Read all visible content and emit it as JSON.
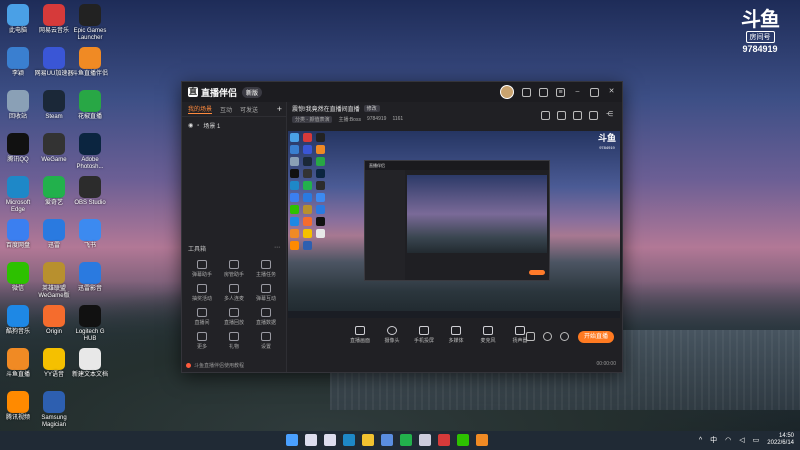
{
  "desktop": {
    "icons": [
      {
        "label": "此电脑",
        "icon": "computer-icon",
        "color": "#4aa0e6"
      },
      {
        "label": "网易云音乐",
        "icon": "netease-music-icon",
        "color": "#d63a3a"
      },
      {
        "label": "Epic Games Launcher",
        "icon": "epic-games-icon",
        "color": "#222"
      },
      {
        "label": "李颖",
        "icon": "folder-icon",
        "color": "#3a7fd0"
      },
      {
        "label": "网易UU加速器",
        "icon": "uu-accelerator-icon",
        "color": "#3a56d6"
      },
      {
        "label": "斗鱼直播伴侣",
        "icon": "douyu-companion-icon",
        "color": "#f08a24"
      },
      {
        "label": "回收站",
        "icon": "recycle-bin-icon",
        "color": "#8aa0b6"
      },
      {
        "label": "Steam",
        "icon": "steam-icon",
        "color": "#1b2838"
      },
      {
        "label": "花椒直播",
        "icon": "huajiao-icon",
        "color": "#28a745"
      },
      {
        "label": "腾讯QQ",
        "icon": "qq-icon",
        "color": "#111"
      },
      {
        "label": "WeGame",
        "icon": "wegame-icon",
        "color": "#333"
      },
      {
        "label": "Adobe Photosh...",
        "icon": "photoshop-icon",
        "color": "#0b2540"
      },
      {
        "label": "Microsoft Edge",
        "icon": "edge-icon",
        "color": "#1e88c8"
      },
      {
        "label": "爱奇艺",
        "icon": "iqiyi-icon",
        "color": "#22b14c"
      },
      {
        "label": "OBS Studio",
        "icon": "obs-icon",
        "color": "#2c2c2c"
      },
      {
        "label": "百度网盘",
        "icon": "baidu-netdisk-icon",
        "color": "#3b7ff0"
      },
      {
        "label": "迅雷",
        "icon": "xunlei-icon",
        "color": "#2a7ae0"
      },
      {
        "label": "飞书",
        "icon": "feishu-icon",
        "color": "#3c8af0"
      },
      {
        "label": "微信",
        "icon": "wechat-icon",
        "color": "#2dc100"
      },
      {
        "label": "英雄联盟 WeGame版",
        "icon": "lol-icon",
        "color": "#b8902e"
      },
      {
        "label": "迅雷影音",
        "icon": "xunlei-player-icon",
        "color": "#2a7ae0"
      },
      {
        "label": "酷狗音乐",
        "icon": "kugou-icon",
        "color": "#1e88e5"
      },
      {
        "label": "Origin",
        "icon": "origin-icon",
        "color": "#f56c2d"
      },
      {
        "label": "Logitech G HUB",
        "icon": "ghub-icon",
        "color": "#111"
      },
      {
        "label": "斗鱼直播",
        "icon": "douyu-icon",
        "color": "#f08a24"
      },
      {
        "label": "YY语音",
        "icon": "yy-icon",
        "color": "#f5c000"
      },
      {
        "label": "新建文本文档",
        "icon": "text-doc-icon",
        "color": "#e8e8e8"
      },
      {
        "label": "腾讯视频",
        "icon": "tencent-video-icon",
        "color": "#ff8a00"
      },
      {
        "label": "Samsung Magician",
        "icon": "samsung-magician-icon",
        "color": "#2d5fb0"
      }
    ]
  },
  "watermark": {
    "logo": "斗鱼",
    "sub": "房间号",
    "room": "9784919"
  },
  "window": {
    "app_name": "直播伴侣",
    "version": "新版",
    "tabs": [
      "我的场景",
      "互动",
      "可发送"
    ],
    "scene": "场景 1",
    "tools_header": "工具箱",
    "tools": [
      {
        "label": "弹幕助手",
        "icon": "danmaku-icon"
      },
      {
        "label": "房管助手",
        "icon": "admin-icon"
      },
      {
        "label": "主播任务",
        "icon": "task-icon"
      },
      {
        "label": "抽奖活动",
        "icon": "lottery-icon"
      },
      {
        "label": "多人连麦",
        "icon": "multi-mic-icon"
      },
      {
        "label": "弹幕互动",
        "icon": "interaction-icon"
      },
      {
        "label": "直播间",
        "icon": "room-icon"
      },
      {
        "label": "直播回放",
        "icon": "replay-icon"
      },
      {
        "label": "直播数据",
        "icon": "data-icon"
      },
      {
        "label": "更多",
        "icon": "more-icon"
      },
      {
        "label": "礼物",
        "icon": "gift-icon"
      },
      {
        "label": "设置",
        "icon": "settings-icon"
      }
    ],
    "notice": "斗鱼直播伴侣使用教程",
    "room_title": "震惊!我竟然在直播间直播",
    "room_title_tag": "修改",
    "room_info_tag": "分类 - 颜值表演",
    "room_anchor": "主播:Boss",
    "room_id": "9784919",
    "room_viewers": "1161",
    "controls": [
      {
        "label": "直播画面",
        "icon": "screen-icon"
      },
      {
        "label": "摄像头",
        "icon": "camera-icon"
      },
      {
        "label": "手机投屏",
        "icon": "phone-cast-icon"
      },
      {
        "label": "多媒体",
        "icon": "media-icon"
      },
      {
        "label": "麦克风",
        "icon": "mic-icon"
      },
      {
        "label": "扬声器",
        "icon": "speaker-icon"
      }
    ],
    "start_button": "开始直播",
    "status_time": "00:00:00"
  },
  "taskbar": {
    "apps": [
      {
        "icon": "windows-start-icon",
        "color": "#4aa0ff"
      },
      {
        "icon": "search-icon",
        "color": "#dde"
      },
      {
        "icon": "task-view-icon",
        "color": "#dde"
      },
      {
        "icon": "edge-icon",
        "color": "#1e88c8"
      },
      {
        "icon": "file-explorer-icon",
        "color": "#f2c230"
      },
      {
        "icon": "store-icon",
        "color": "#5a8de0"
      },
      {
        "icon": "iqiyi-icon",
        "color": "#22b14c"
      },
      {
        "icon": "notion-icon",
        "color": "#ccd"
      },
      {
        "icon": "netease-music-icon",
        "color": "#d63a3a"
      },
      {
        "icon": "wechat-icon",
        "color": "#2dc100"
      },
      {
        "icon": "douyu-companion-icon",
        "color": "#f08a24"
      }
    ],
    "tray_lang": "中",
    "time": "14:50",
    "date": "2022/6/14"
  }
}
